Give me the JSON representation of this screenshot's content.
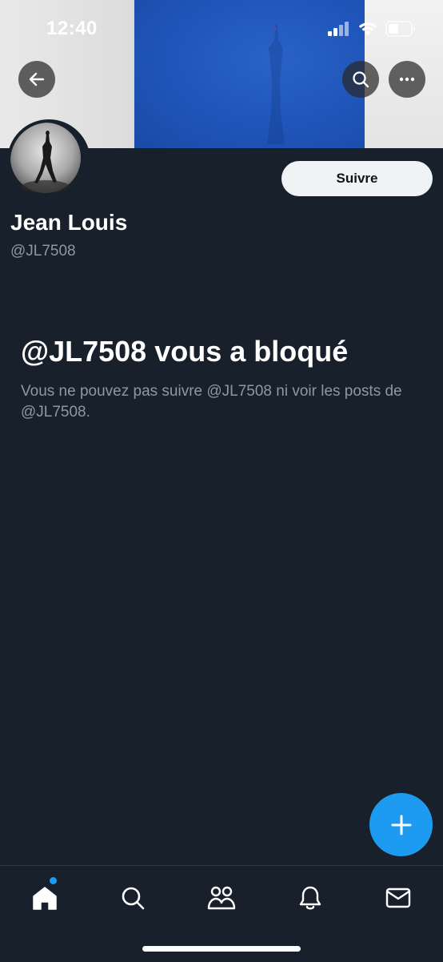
{
  "status_bar": {
    "time": "12:40"
  },
  "header": {
    "back_icon": "arrow-left-icon",
    "search_icon": "search-icon",
    "more_icon": "more-horizontal-icon"
  },
  "profile": {
    "name": "Jean Louis",
    "handle": "@JL7508",
    "follow_label": "Suivre"
  },
  "blocked": {
    "title": "@JL7508 vous a bloqué",
    "message": "Vous ne pouvez pas suivre @JL7508 ni voir les posts de @JL7508."
  },
  "fab": {
    "icon": "plus-icon"
  },
  "tabbar": {
    "items": [
      {
        "icon": "home-icon",
        "active": true
      },
      {
        "icon": "search-icon"
      },
      {
        "icon": "communities-icon"
      },
      {
        "icon": "notifications-icon"
      },
      {
        "icon": "messages-icon"
      }
    ]
  },
  "colors": {
    "accent": "#1d9bf0",
    "background": "#17202b",
    "muted_text": "#8b98a5"
  }
}
